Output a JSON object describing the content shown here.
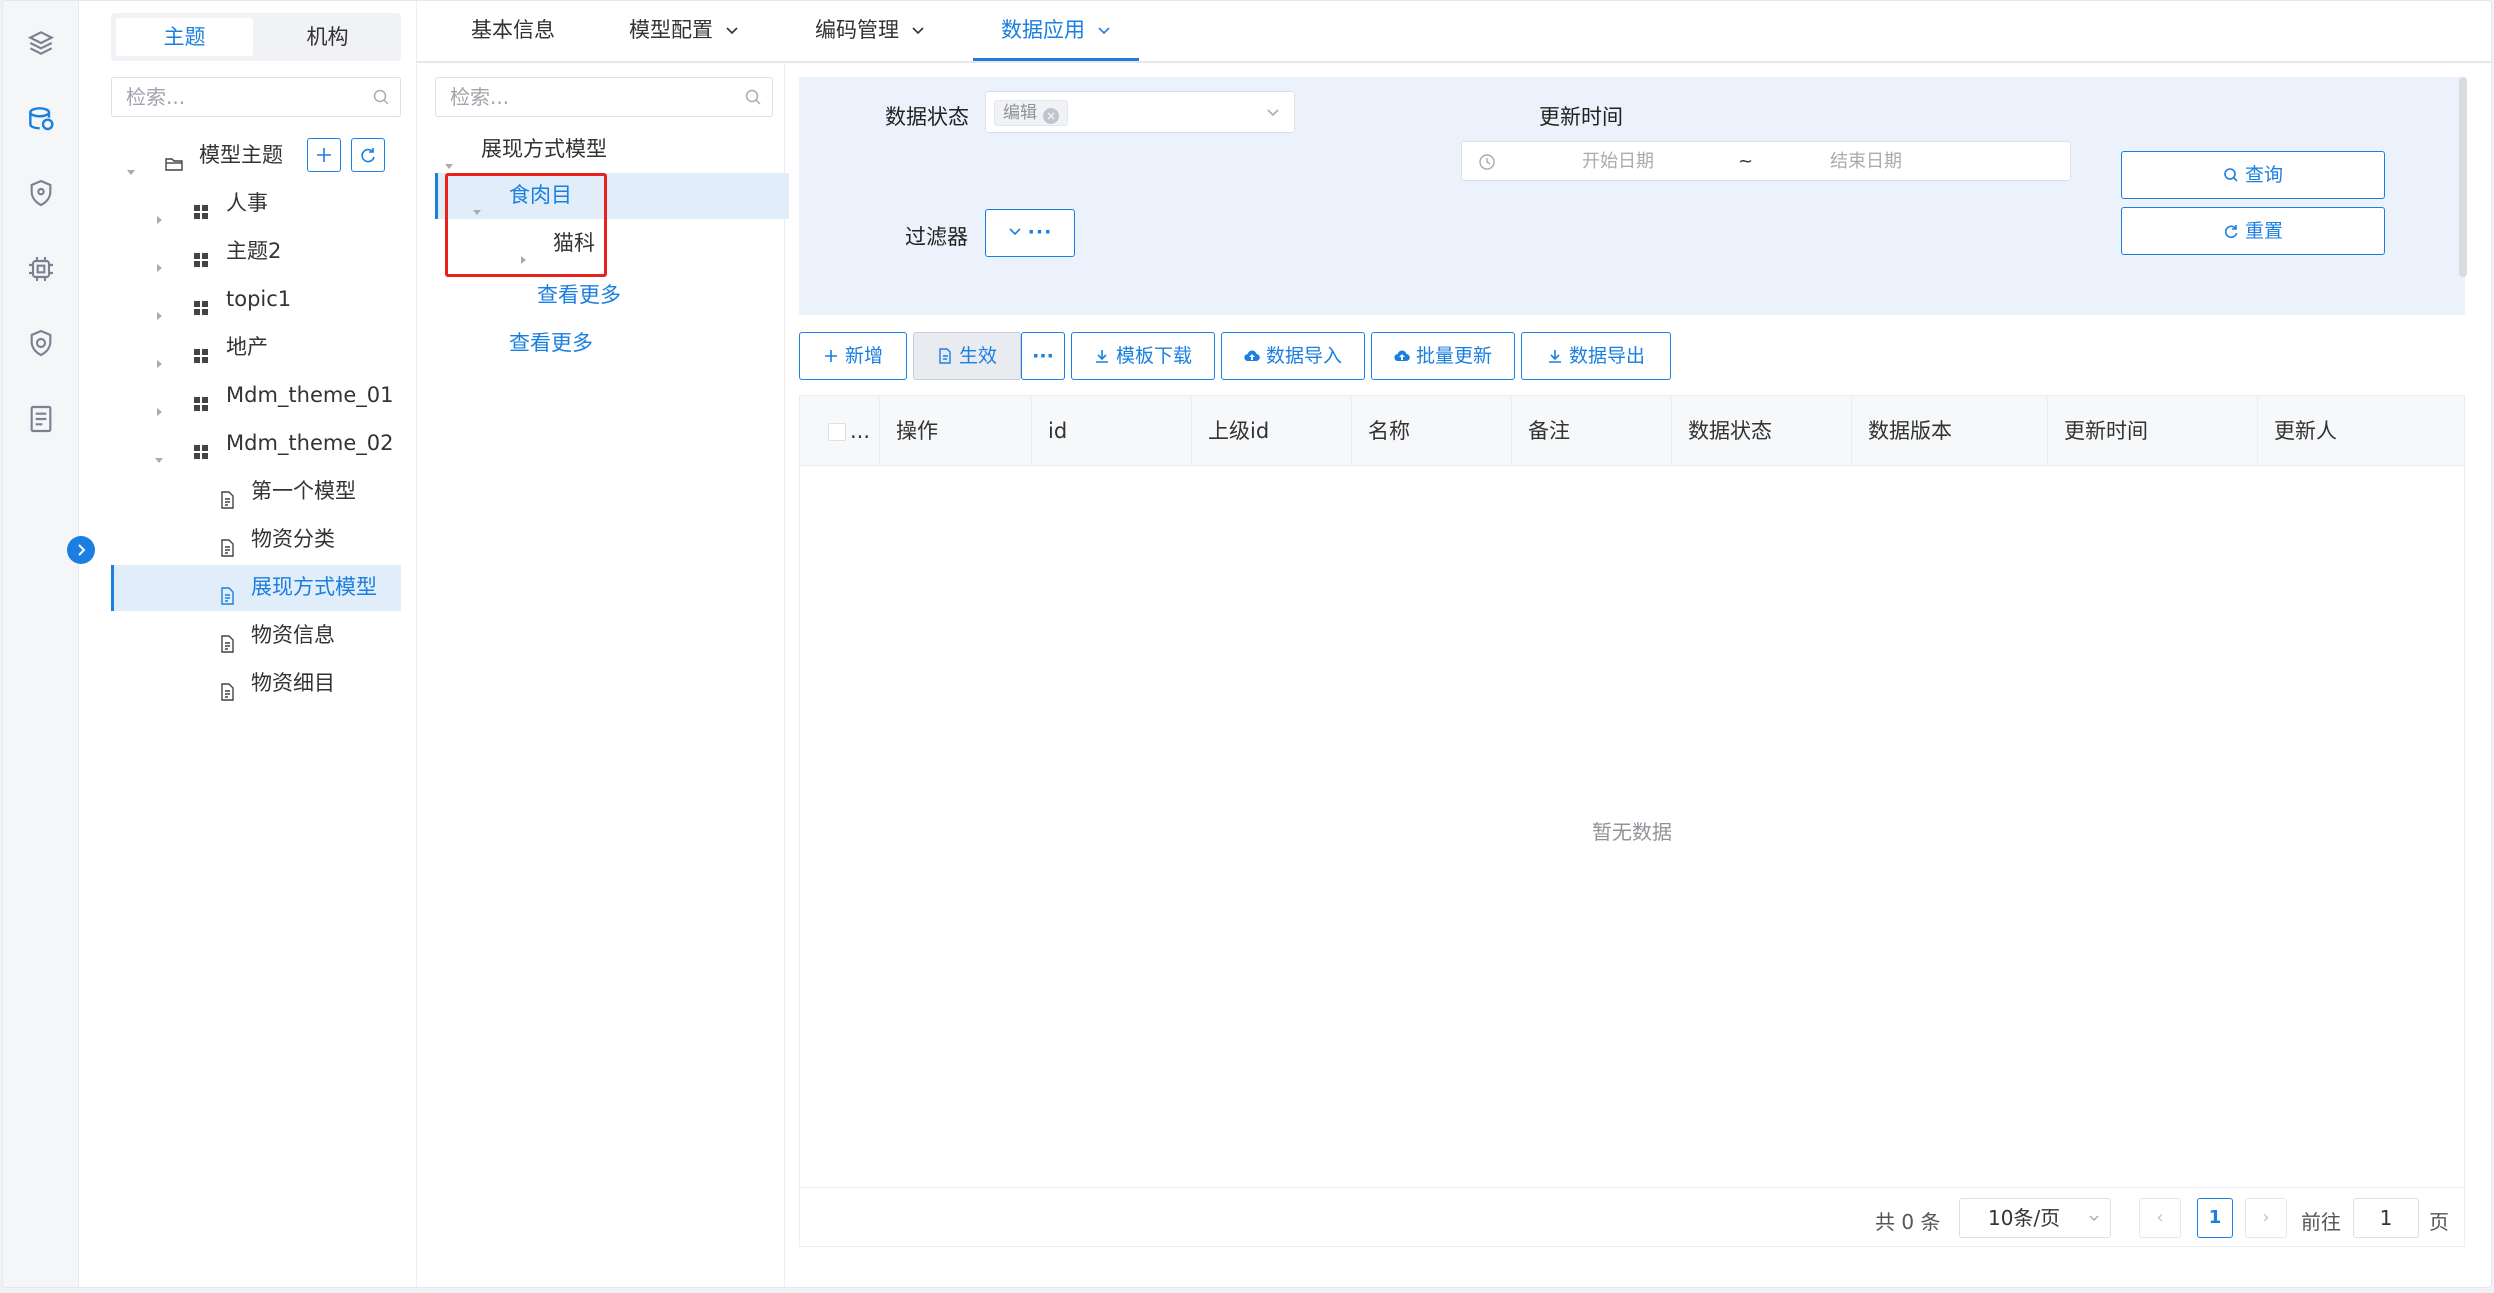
{
  "rail": {
    "icons": [
      "layers-icon",
      "database-icon",
      "shield-icon",
      "chip-icon",
      "shield-check-icon",
      "document-list-icon"
    ],
    "active_index": 1
  },
  "left_panel": {
    "tabs": [
      "主题",
      "机构"
    ],
    "search_placeholder": "检索...",
    "root_label": "模型主题",
    "topics": [
      "人事",
      "主题2",
      "topic1",
      "地产",
      "Mdm_theme_01",
      "Mdm_theme_02"
    ],
    "models": [
      "第一个模型",
      "物资分类",
      "展现方式模型",
      "物资信息",
      "物资细目"
    ],
    "selected_model": "展现方式模型"
  },
  "tabs": [
    {
      "label": "基本信息",
      "has_dropdown": false
    },
    {
      "label": "模型配置",
      "has_dropdown": true
    },
    {
      "label": "编码管理",
      "has_dropdown": true
    },
    {
      "label": "数据应用",
      "has_dropdown": true,
      "active": true
    }
  ],
  "mid_tree": {
    "search_placeholder": "检索...",
    "root": "展现方式模型",
    "child": "食肉目",
    "grandchild": "猫科",
    "more_inner": "查看更多",
    "more_outer": "查看更多"
  },
  "filter": {
    "status_label": "数据状态",
    "status_tag": "编辑",
    "update_time_label": "更新时间",
    "start_placeholder": "开始日期",
    "range_sep": "~",
    "end_placeholder": "结束日期",
    "filter_label": "过滤器",
    "query_label": "查询",
    "reset_label": "重置"
  },
  "toolbar": {
    "add": "新增",
    "effective": "生效",
    "more": "···",
    "template_download": "模板下载",
    "data_import": "数据导入",
    "batch_update": "批量更新",
    "data_export": "数据导出"
  },
  "table": {
    "columns": [
      "操作",
      "id",
      "上级id",
      "名称",
      "备注",
      "数据状态",
      "数据版本",
      "更新时间",
      "更新人"
    ],
    "select_col_text": "...",
    "empty_text": "暂无数据"
  },
  "pager": {
    "total": "共 0 条",
    "page_size": "10条/页",
    "current_page": "1",
    "goto_label": "前往",
    "goto_value": "1",
    "page_suffix": "页"
  },
  "colors": {
    "accent": "#1a7fe0",
    "highlight_box": "#e8201e",
    "filter_bg": "#ecf2fb"
  }
}
